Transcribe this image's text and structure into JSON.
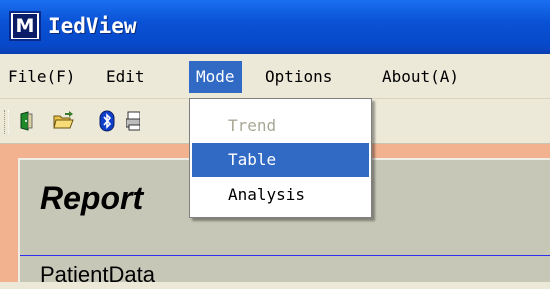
{
  "window": {
    "title": "IedView",
    "icon_letter": "M"
  },
  "menubar": {
    "items": [
      {
        "label": "File(F)"
      },
      {
        "label": "Edit"
      },
      {
        "label": "Mode"
      },
      {
        "label": "Options"
      },
      {
        "label": "About(A)"
      }
    ],
    "active": "Mode"
  },
  "toolbar": {
    "buttons": [
      {
        "icon": "green-door-icon"
      },
      {
        "icon": "open-folder-icon"
      },
      {
        "icon": "bluetooth-icon"
      },
      {
        "icon": "print-icon"
      }
    ]
  },
  "mode_menu": {
    "items": [
      {
        "label": "Trend",
        "enabled": false
      },
      {
        "label": "Table",
        "enabled": true,
        "highlighted": true
      },
      {
        "label": "Analysis",
        "enabled": true
      }
    ]
  },
  "report": {
    "title": "Report",
    "section": "PatientData"
  },
  "colors": {
    "titlebar": "#0a52d6",
    "highlight": "#316ac5",
    "content_bg": "#f2b18f",
    "panel_bg": "#c7c7b7",
    "divider": "#2e2ef0"
  }
}
